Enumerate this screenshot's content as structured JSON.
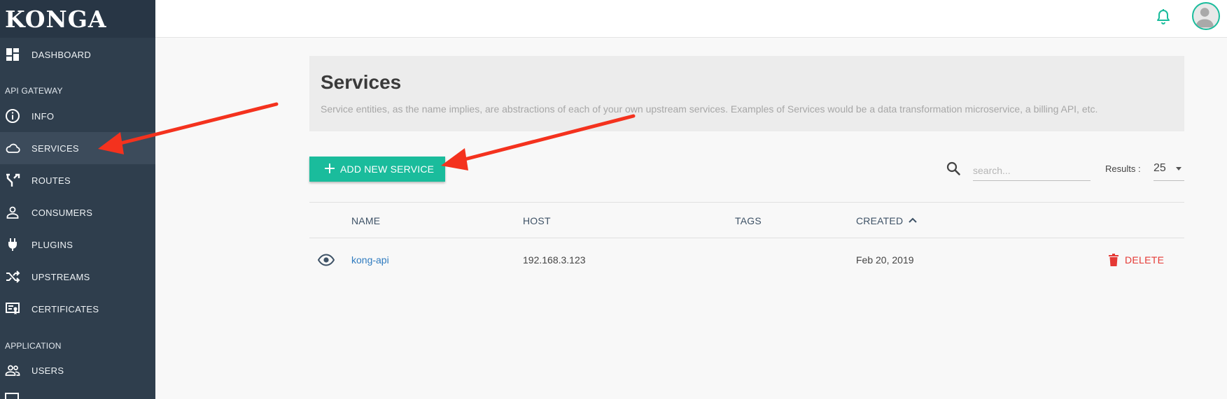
{
  "app": {
    "brand": "KONGA"
  },
  "sidebar": {
    "dashboard": "DASHBOARD",
    "section_gateway": "API GATEWAY",
    "gateway_items": [
      {
        "label": "INFO",
        "icon": "info-icon"
      },
      {
        "label": "SERVICES",
        "icon": "cloud-icon"
      },
      {
        "label": "ROUTES",
        "icon": "fork-icon"
      },
      {
        "label": "CONSUMERS",
        "icon": "person-icon"
      },
      {
        "label": "PLUGINS",
        "icon": "plug-icon"
      },
      {
        "label": "UPSTREAMS",
        "icon": "shuffle-icon"
      },
      {
        "label": "CERTIFICATES",
        "icon": "certificate-icon"
      }
    ],
    "section_application": "APPLICATION",
    "application_items": [
      {
        "label": "USERS",
        "icon": "users-icon"
      }
    ],
    "active": "SERVICES"
  },
  "header": {
    "title": "Services",
    "description": "Service entities, as the name implies, are abstractions of each of your own upstream services. Examples of Services would be a data transformation microservice, a billing API, etc."
  },
  "toolbar": {
    "add_label": "ADD NEW SERVICE",
    "search_placeholder": "search...",
    "results_label": "Results :",
    "results_value": "25"
  },
  "table": {
    "columns": [
      "NAME",
      "HOST",
      "TAGS",
      "CREATED"
    ],
    "sort_column": "CREATED",
    "sort_direction": "ascending",
    "rows": [
      {
        "name": "kong-api",
        "host": "192.168.3.123",
        "tags": "",
        "created": "Feb 20, 2019",
        "action": "DELETE"
      }
    ]
  },
  "colors": {
    "sidebar_bg": "#2f3e4d",
    "accent": "#1abc9c",
    "danger": "#e53935",
    "link": "#2f7bbf",
    "annotation": "#f4321e"
  }
}
